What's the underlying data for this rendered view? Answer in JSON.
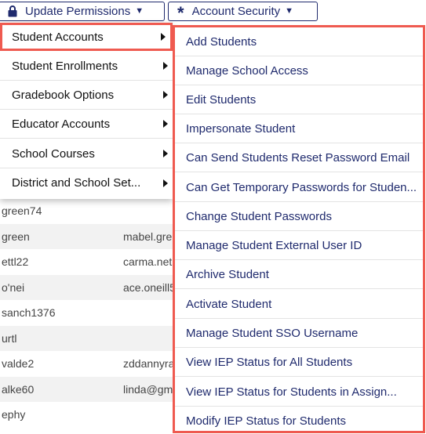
{
  "toolbar": {
    "update_permissions_label": "Update Permissions",
    "account_security_label": "Account Security"
  },
  "left_menu": {
    "items": [
      {
        "label": "Student Accounts"
      },
      {
        "label": "Student Enrollments"
      },
      {
        "label": "Gradebook Options"
      },
      {
        "label": "Educator Accounts"
      },
      {
        "label": "School Courses"
      },
      {
        "label": "District and School Set..."
      }
    ]
  },
  "submenu": {
    "items": [
      {
        "label": "Add Students"
      },
      {
        "label": "Manage School Access"
      },
      {
        "label": "Edit Students"
      },
      {
        "label": "Impersonate Student"
      },
      {
        "label": "Can Send Students Reset Password Email"
      },
      {
        "label": "Can Get Temporary Passwords for Studen..."
      },
      {
        "label": "Change Student Passwords"
      },
      {
        "label": "Manage Student External User ID"
      },
      {
        "label": "Archive Student"
      },
      {
        "label": "Activate Student"
      },
      {
        "label": "Manage Student SSO Username"
      },
      {
        "label": "View IEP Status for All Students"
      },
      {
        "label": "View IEP Status for Students in Assign..."
      },
      {
        "label": "Modify IEP Status for Students"
      }
    ]
  },
  "background_table": {
    "rows": [
      {
        "c1": "green74",
        "c2": ""
      },
      {
        "c1": "green",
        "c2": "mabel.gre"
      },
      {
        "c1": "ettl22",
        "c2": "carma.net"
      },
      {
        "c1": "o'nei",
        "c2": "ace.oneill5"
      },
      {
        "c1": "sanch1376",
        "c2": ""
      },
      {
        "c1": "urtl",
        "c2": ""
      },
      {
        "c1": "valde2",
        "c2": "zddannyra"
      },
      {
        "c1": "alke60",
        "c2": "linda@gm"
      },
      {
        "c1": "ephy",
        "c2": ""
      }
    ]
  },
  "colors": {
    "navy": "#1f2a6d",
    "highlight_red": "#ef5a50"
  },
  "icons": {
    "update_permissions": "lock-icon",
    "account_security": "asterisk-icon",
    "dropdown": "caret-down-icon",
    "submenu_arrow": "triangle-right-icon"
  }
}
